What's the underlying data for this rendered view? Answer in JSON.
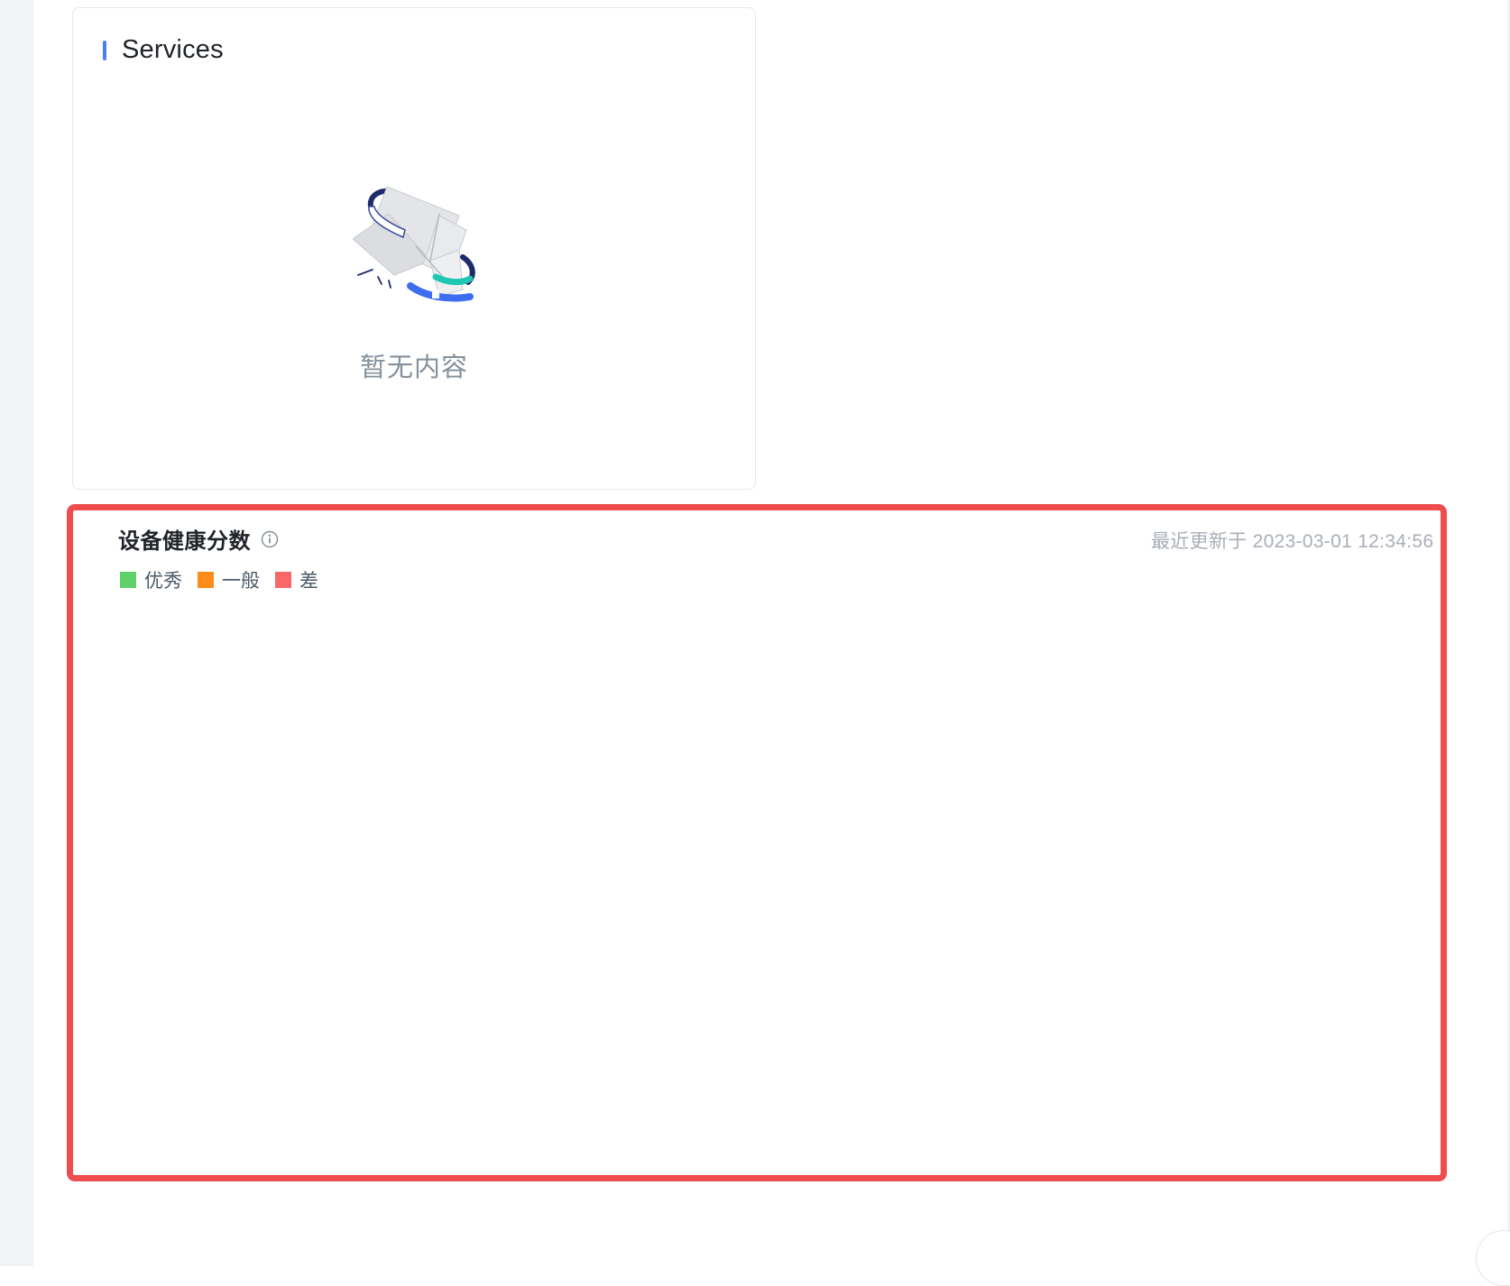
{
  "services_card": {
    "title": "Services",
    "empty_text": "暂无内容"
  },
  "health_card": {
    "title": "设备健康分数",
    "updated_text": "最近更新于 2023-03-01 12:34:56",
    "legend": [
      {
        "label": "优秀",
        "color": "#5fd068"
      },
      {
        "label": "一般",
        "color": "#ff8c1a"
      },
      {
        "label": "差",
        "color": "#f76866"
      }
    ],
    "highlight_color": "#ef4c4e"
  },
  "colors": {
    "accent": "#4a7cf6",
    "muted_text": "#86909c"
  }
}
